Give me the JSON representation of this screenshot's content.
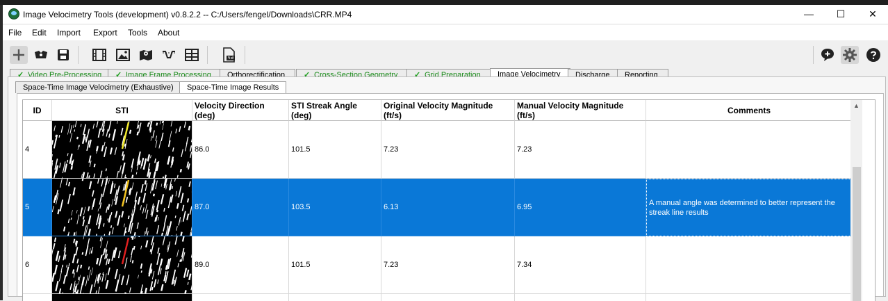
{
  "window": {
    "title": "Image Velocimetry Tools (development) v0.8.2.2 -- C:/Users/fengel/Downloads\\CRR.MP4",
    "minimize_glyph": "—",
    "maximize_glyph": "☐",
    "close_glyph": "✕"
  },
  "menu": [
    "File",
    "Edit",
    "Import",
    "Export",
    "Tools",
    "About"
  ],
  "toolbar": {
    "icons": [
      "add-icon",
      "open-project-icon",
      "save-icon",
      "video-icon",
      "image-icon",
      "map-icon",
      "cross-section-icon",
      "table-icon",
      "pdf-icon",
      "add-comment-icon",
      "settings-icon",
      "help-icon"
    ]
  },
  "tabs": [
    {
      "label": "Video Pre-Processing",
      "checked": true
    },
    {
      "label": "Image Frame Processing",
      "checked": true
    },
    {
      "label": "Orthorectification",
      "checked": false
    },
    {
      "label": "Cross-Section Geometry",
      "checked": true
    },
    {
      "label": "Grid Preparation",
      "checked": true
    },
    {
      "label": "Image Velocimetry",
      "checked": false,
      "selected": true
    },
    {
      "label": "Discharge",
      "checked": false
    },
    {
      "label": "Reporting",
      "checked": false
    }
  ],
  "subtabs": [
    {
      "label": "Space-Time Image Velocimetry (Exhaustive)"
    },
    {
      "label": "Space-Time Image Results",
      "selected": true
    }
  ],
  "table": {
    "headers": [
      "ID",
      "STI",
      "Velocity Direction (deg)",
      "STI Streak Angle (deg)",
      "Original Velocity Magnitude (ft/s)",
      "Manual Velocity Magnitude (ft/s)",
      "Comments"
    ],
    "rows": [
      {
        "id": "4",
        "dir": "86.0",
        "streak": "101.5",
        "orig": "7.23",
        "manual": "7.23",
        "comment": "",
        "selected": false,
        "streak_color": "#f2ea2a"
      },
      {
        "id": "5",
        "dir": "87.0",
        "streak": "103.5",
        "orig": "6.13",
        "manual": "6.95",
        "comment": "A manual angle was determined to better represent the streak line results",
        "selected": true,
        "streak_color": "#f2c21e"
      },
      {
        "id": "6",
        "dir": "89.0",
        "streak": "101.5",
        "orig": "7.23",
        "manual": "7.34",
        "comment": "",
        "selected": false,
        "streak_color": "#e02020"
      }
    ]
  },
  "colors": {
    "selection": "#0a78d7",
    "tab_checked": "#1c9e1c"
  }
}
